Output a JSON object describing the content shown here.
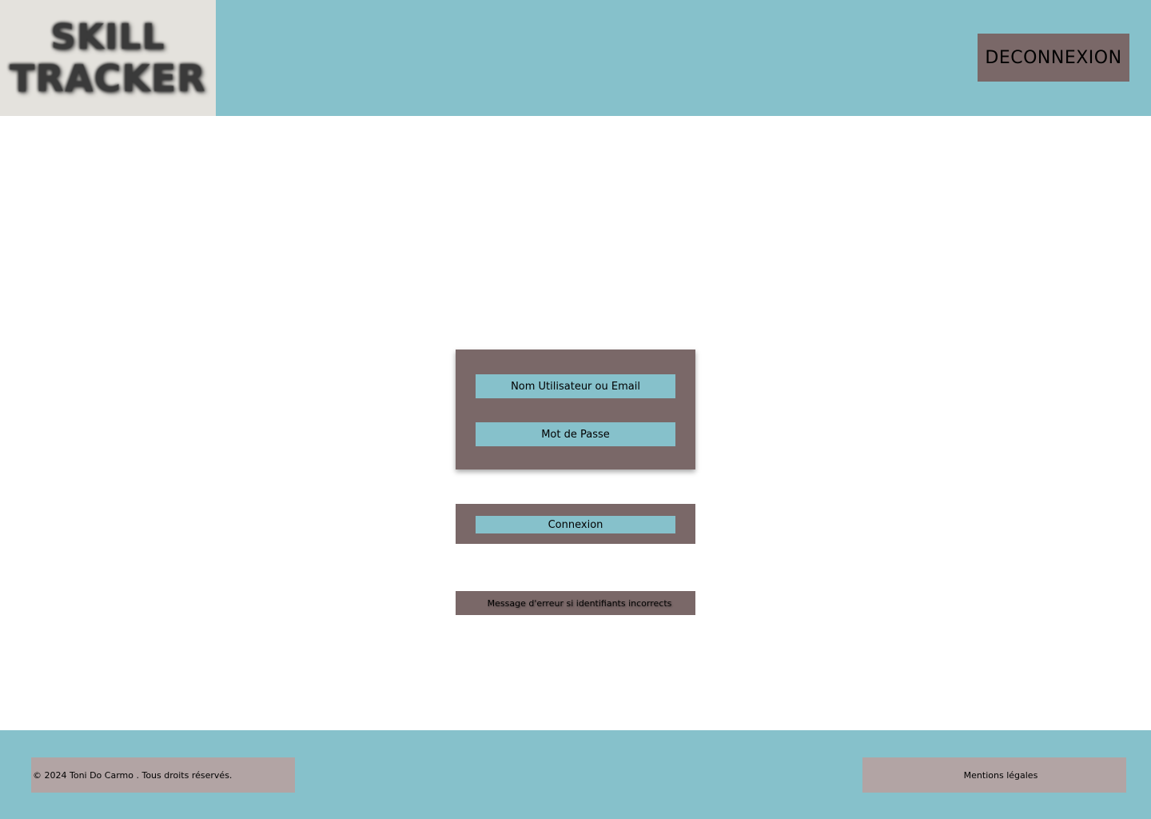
{
  "header": {
    "logo_line1": "SKILL",
    "logo_line2": "TRACKER",
    "logout_label": "DECONNEXION"
  },
  "login": {
    "username_placeholder": "Nom Utilisateur ou Email",
    "password_placeholder": "Mot de Passe",
    "connect_label": "Connexion",
    "error_message": "Message d'erreur si identifiants incorrects"
  },
  "footer": {
    "copyright": "© 2024 Toni Do Carmo . Tous droits réservés.",
    "legal_label": "Mentions légales"
  },
  "colors": {
    "header_bg": "#86c1cb",
    "logo_bg": "#e4e2dd",
    "panel_bg": "#7a6868",
    "field_bg": "#86c1cb",
    "footer_box_bg": "#b2a4a4"
  }
}
